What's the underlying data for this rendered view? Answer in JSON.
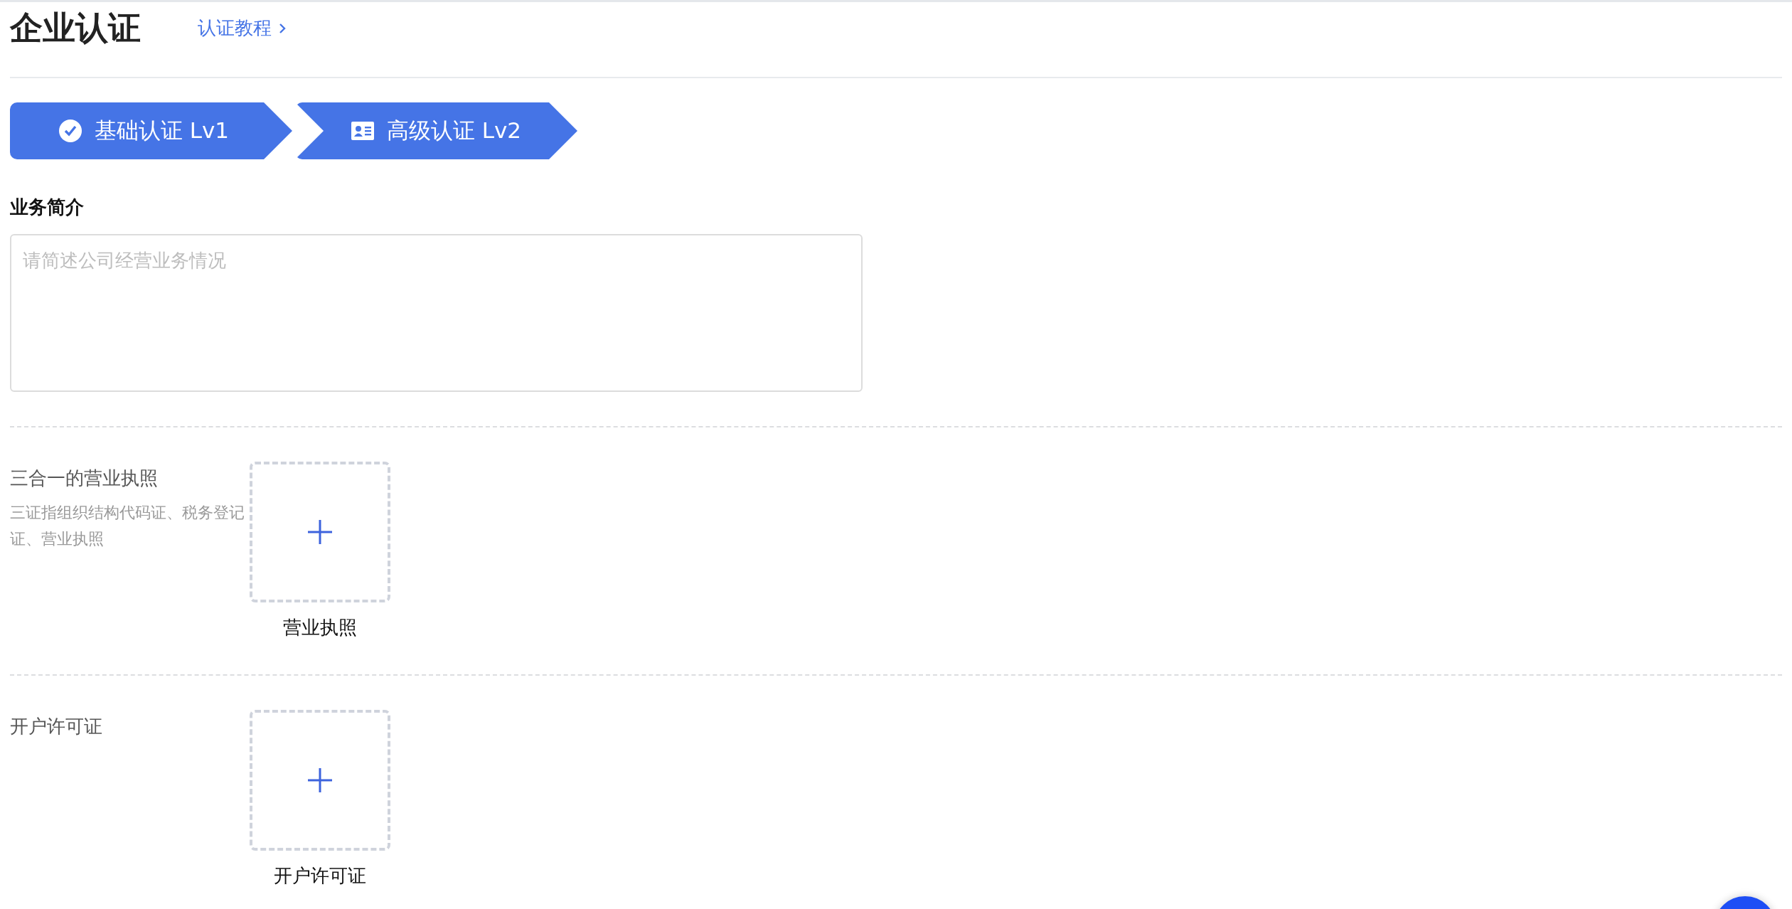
{
  "page": {
    "title": "企业认证",
    "tutorial_link": "认证教程"
  },
  "steps": [
    {
      "label": "基础认证 Lv1",
      "kind": "check"
    },
    {
      "label": "高级认证 Lv2",
      "kind": "card"
    }
  ],
  "description": {
    "label": "业务简介",
    "placeholder": "请简述公司经营业务情况"
  },
  "uploads": [
    {
      "label": "三合一的营业执照",
      "hint": "三证指组织结构代码证、税务登记证、营业执照",
      "caption": "营业执照"
    },
    {
      "label": "开户许可证",
      "caption": "开户许可证"
    }
  ]
}
